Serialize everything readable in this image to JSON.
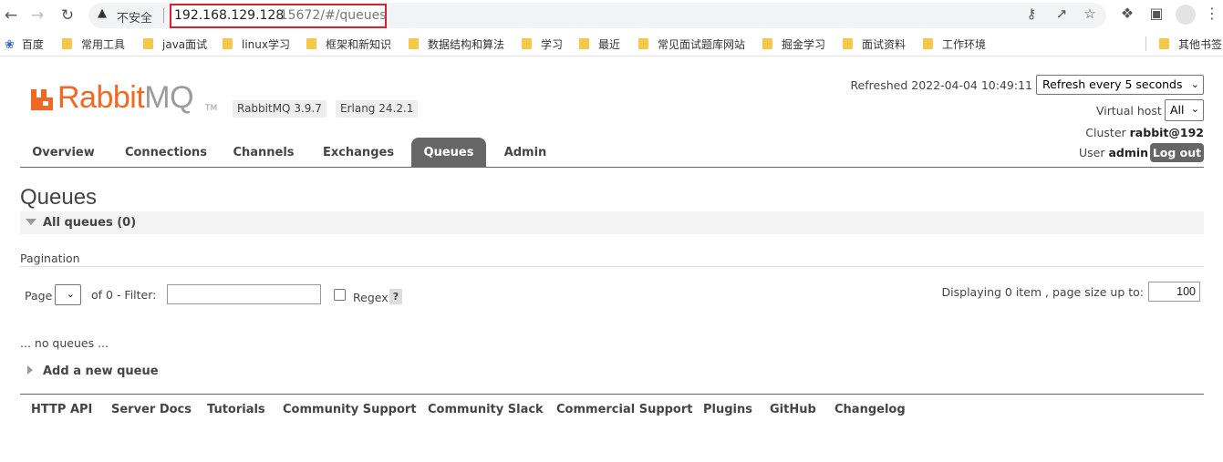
{
  "browser": {
    "security_label": "不安全",
    "url_host": "192.168.129.128",
    "url_rest": ":15672/#/queues",
    "bookmarks": [
      "百度",
      "常用工具",
      "java面试",
      "linux学习",
      "框架和新知识",
      "数据结构和算法",
      "学习",
      "最近",
      "常见面试题库网站",
      "掘金学习",
      "面试资料",
      "工作环境"
    ],
    "other_bookmarks": "其他书签"
  },
  "header": {
    "logo_rabbit": "Rabbit",
    "logo_mq": "MQ",
    "logo_tm": "TM",
    "version_badge": "RabbitMQ 3.9.7",
    "erlang_badge": "Erlang 24.2.1",
    "refreshed": "Refreshed 2022-04-04 10:49:11",
    "refresh_select": "Refresh every 5 seconds",
    "vhost_label": "Virtual host",
    "vhost_value": "All",
    "cluster_label": "Cluster",
    "cluster_value": "rabbit@192",
    "user_label": "User",
    "user_value": "admin",
    "logout_label": "Log out"
  },
  "tabs": [
    "Overview",
    "Connections",
    "Channels",
    "Exchanges",
    "Queues",
    "Admin"
  ],
  "active_tab": "Queues",
  "main": {
    "title": "Queues",
    "section_title": "All queues (0)",
    "pagination_label": "Pagination",
    "page_label": "Page",
    "of_label": "of 0  - Filter:",
    "filter_value": "",
    "regex_label": "Regex",
    "help_label": "?",
    "displaying": "Displaying 0 item , page size up to:",
    "page_size": "100",
    "no_queues": "... no queues ...",
    "add_queue": "Add a new queue"
  },
  "footer": [
    "HTTP API",
    "Server Docs",
    "Tutorials",
    "Community Support",
    "Community Slack",
    "Commercial Support",
    "Plugins",
    "GitHub",
    "Changelog"
  ],
  "colors": {
    "brand_orange": "#f26822",
    "tab_active": "#666666",
    "url_highlight": "#d9232c"
  }
}
